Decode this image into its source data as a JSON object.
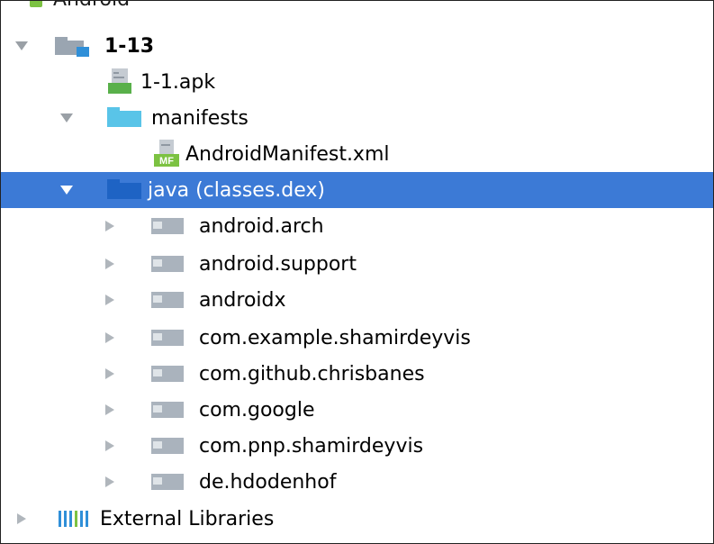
{
  "header": {
    "label": "Android"
  },
  "tree": {
    "module": {
      "label": "1-13"
    },
    "apk": {
      "label": "1-1.apk"
    },
    "manifests": {
      "label": "manifests"
    },
    "manifest_file": {
      "label": "AndroidManifest.xml",
      "badge": "MF"
    },
    "java": {
      "label": "java (classes.dex)"
    },
    "packages": [
      {
        "label": "android.arch"
      },
      {
        "label": "android.support"
      },
      {
        "label": "androidx"
      },
      {
        "label": "com.example.shamirdeyvis"
      },
      {
        "label": "com.github.chrisbanes"
      },
      {
        "label": "com.google"
      },
      {
        "label": "com.pnp.shamirdeyvis"
      },
      {
        "label": "de.hdodenhof"
      }
    ],
    "external": {
      "label": "External Libraries"
    }
  },
  "colors": {
    "selection": "#3c7ad6",
    "folder_blue": "#59c4e8",
    "package_gray": "#aab3bd",
    "module_gray": "#9aa5b1",
    "android_green": "#7cc242"
  },
  "icons": {
    "collapse": "triangle-down-icon",
    "expand": "triangle-right-icon",
    "module": "module-folder-icon",
    "apk": "apk-file-icon",
    "folder": "folder-icon",
    "package": "package-icon",
    "manifest": "manifest-file-icon",
    "libraries": "libraries-icon"
  }
}
